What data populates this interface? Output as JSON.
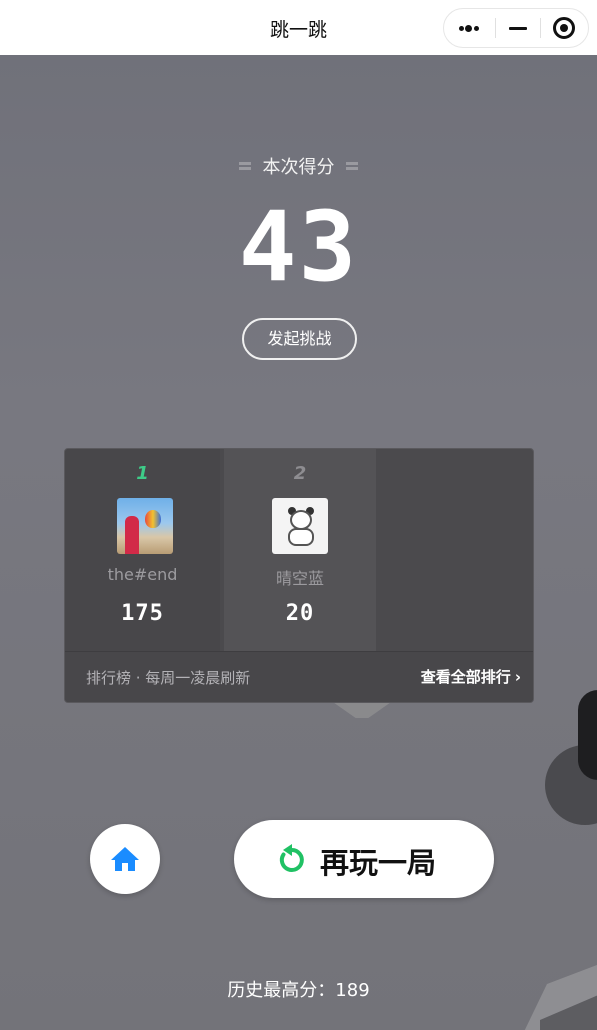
{
  "navbar": {
    "title": "跳一跳",
    "more_icon": "more-dots-icon",
    "minimize_icon": "minimize-icon",
    "close_icon": "target-close-icon"
  },
  "score_section": {
    "label": "本次得分",
    "score": "43",
    "challenge_label": "发起挑战"
  },
  "leaderboard": {
    "entries": [
      {
        "rank": "1",
        "name": "the#end",
        "score": "175",
        "avatar": "balloon-photo-avatar"
      },
      {
        "rank": "2",
        "name": "晴空蓝",
        "score": "20",
        "avatar": "panda-cartoon-avatar"
      }
    ],
    "note": "排行榜 · 每周一凌晨刷新",
    "view_all_label": "查看全部排行",
    "chevron": "›"
  },
  "controls": {
    "home_icon": "home-icon",
    "replay_icon": "refresh-icon",
    "replay_label": "再玩一局"
  },
  "history": {
    "best_text": "历史最高分：189"
  },
  "colors": {
    "accent_green": "#3ecb88",
    "home_blue": "#1a8cff",
    "replay_green": "#20c164"
  }
}
